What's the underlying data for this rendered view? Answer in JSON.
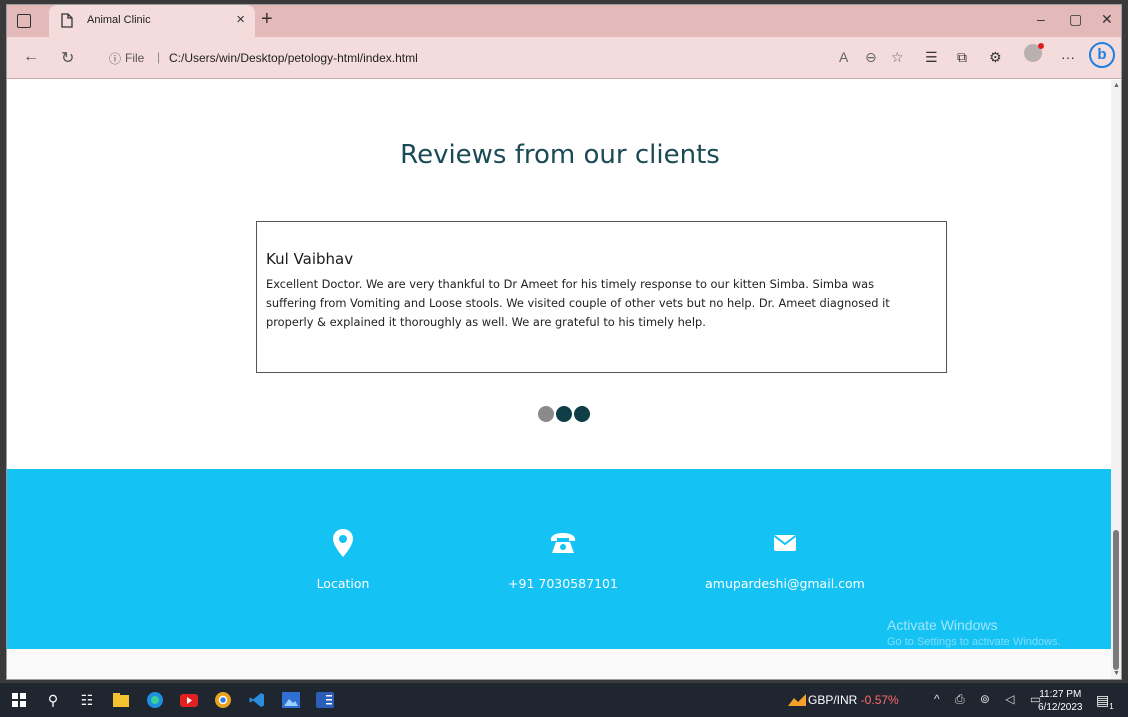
{
  "browser": {
    "tab_title": "Animal Clinic",
    "tab_close": "×",
    "new_tab": "+",
    "url_prefix": "File",
    "url_separator": "|",
    "url": "C:/Users/win/Desktop/petology-html/index.html",
    "minimize": "–",
    "restore": "▢",
    "close": "✕",
    "more": "···",
    "bing": "b"
  },
  "page": {
    "reviews_heading": "Reviews from our clients",
    "review": {
      "name": "Kul Vaibhav",
      "text": "Excellent Doctor. We are very thankful to Dr Ameet for his timely response to our kitten Simba. Simba was suffering from Vomiting and Loose stools. We visited couple of other vets but no help. Dr. Ameet diagnosed it properly & explained it thoroughly as well. We are grateful to his timely help."
    },
    "carousel": {
      "active_index": 0,
      "count": 3,
      "inactive_color": "#8a8a8a",
      "active_color": "#0f3e47"
    },
    "footer": {
      "background": "#14c2f4",
      "location_label": "Location",
      "phone_label": "+91 7030587101",
      "email_label": "amupardeshi@gmail.com"
    },
    "watermark": {
      "title": "Activate Windows",
      "subtitle": "Go to Settings to activate Windows."
    }
  },
  "taskbar": {
    "ticker_label": "GBP/INR",
    "ticker_change": "-0.57%",
    "time": "11:27 PM",
    "date": "6/12/2023",
    "notification_count": "1"
  }
}
